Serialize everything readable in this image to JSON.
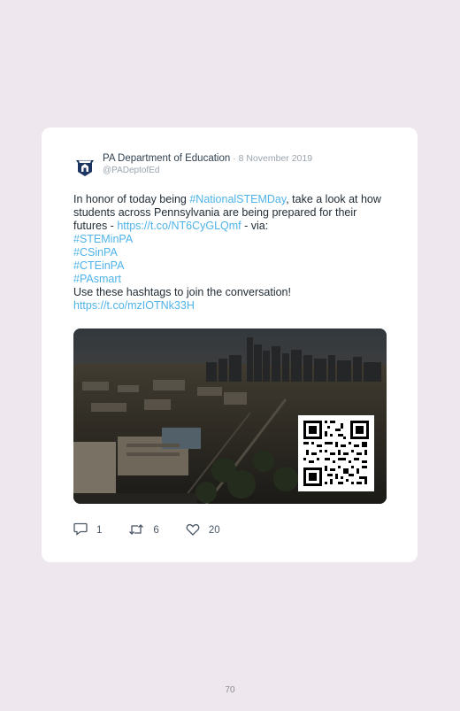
{
  "tweet": {
    "author_name": "PA Department of Education",
    "date": " · 8 November 2019",
    "handle": "@PADeptofEd",
    "line1_pre": "In honor of today being ",
    "hashtag_stem": "#NationalSTEMDay",
    "line1_post": ", take a look at how students across Pennsylvania are being prepared for their futures - ",
    "link1": "https://t.co/NT6CyGLQmf",
    "link1_post": " - via:",
    "hashtags": [
      "#STEMinPA",
      "#CSinPA",
      "#CTEinPA",
      "#PAsmart"
    ],
    "closing": "Use these hashtags to join the conversation!",
    "link2": "https://t.co/mzIOTNk33H"
  },
  "actions": {
    "replies": "1",
    "retweets": "6",
    "likes": "20"
  },
  "icons": {
    "avatar": "pa-keystone-logo-icon",
    "reply": "reply-bubble-icon",
    "retweet": "retweet-icon",
    "like": "heart-icon"
  },
  "colors": {
    "link": "#4fb3e8",
    "background": "#eee7ee",
    "card": "#ffffff"
  },
  "page_number": "70"
}
